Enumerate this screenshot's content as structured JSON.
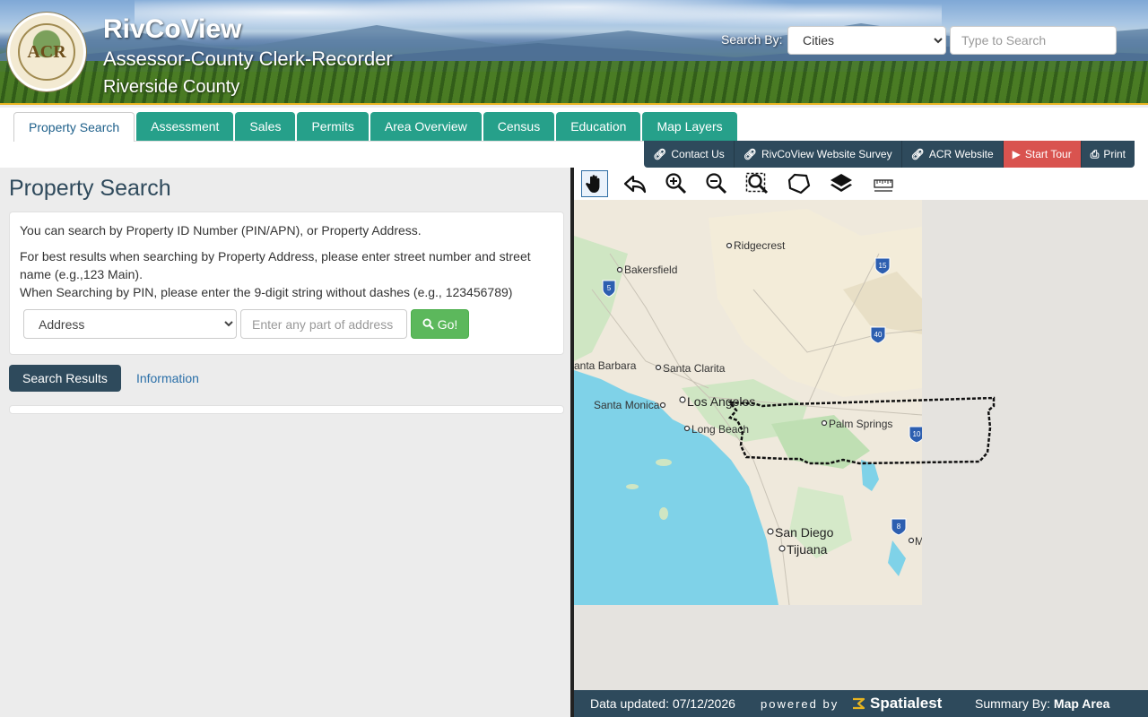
{
  "header": {
    "app_title": "RivCoView",
    "subtitle": "Assessor-County Clerk-Recorder",
    "county": "Riverside County",
    "logo_text": "ACR",
    "search_by_label": "Search By:",
    "search_by_value": "Cities",
    "search_placeholder": "Type to Search"
  },
  "tabs": [
    {
      "label": "Property Search",
      "active": true
    },
    {
      "label": "Assessment"
    },
    {
      "label": "Sales"
    },
    {
      "label": "Permits"
    },
    {
      "label": "Area Overview"
    },
    {
      "label": "Census"
    },
    {
      "label": "Education"
    },
    {
      "label": "Map Layers"
    }
  ],
  "actions": {
    "contact": "Contact Us",
    "survey": "RivCoView Website Survey",
    "acr": "ACR Website",
    "tour": "Start Tour",
    "print": "Print"
  },
  "panel": {
    "title": "Property Search",
    "intro": "You can search by Property ID Number (PIN/APN), or Property Address.",
    "hint1": "For best results when searching by Property Address, please enter street number and street name (e.g.,123 Main).",
    "hint2": "When Searching by PIN, please enter the 9-digit string without dashes (e.g., 123456789)",
    "search_type": "Address",
    "address_placeholder": "Enter any part of address",
    "go_label": "Go!",
    "results_tab": "Search Results",
    "info_tab": "Information"
  },
  "map": {
    "tools": [
      "pan-icon",
      "back-icon",
      "zoom-in-icon",
      "zoom-out-icon",
      "zoom-extent-icon",
      "polygon-icon",
      "layers-icon",
      "measure-icon"
    ],
    "cities": {
      "ridgecrest": "Ridgecrest",
      "bakersfield": "Bakersfield",
      "santa_barbara": "anta Barbara",
      "santa_clarita": "Santa Clarita",
      "los_angeles": "Los Angeles",
      "santa_monica": "Santa Monica",
      "long_beach": "Long Beach",
      "palm_springs": "Palm Springs",
      "san_diego": "San Diego",
      "tijuana": "Tijuana",
      "m": "M"
    },
    "highways": {
      "i5": "5",
      "i15": "15",
      "i40": "40",
      "i10": "10",
      "i8": "8"
    }
  },
  "footer": {
    "data_updated": "Data updated: 07/12/2026",
    "powered_by": "powered by",
    "brand": "Spatialest",
    "summary_label": "Summary By:",
    "summary_value": "Map Area"
  },
  "colors": {
    "tab_green": "#26a08a",
    "dark_nav": "#2e4a5c",
    "tour_red": "#d9534f",
    "go_green": "#5cb85c",
    "header_gold": "#e8b420"
  }
}
